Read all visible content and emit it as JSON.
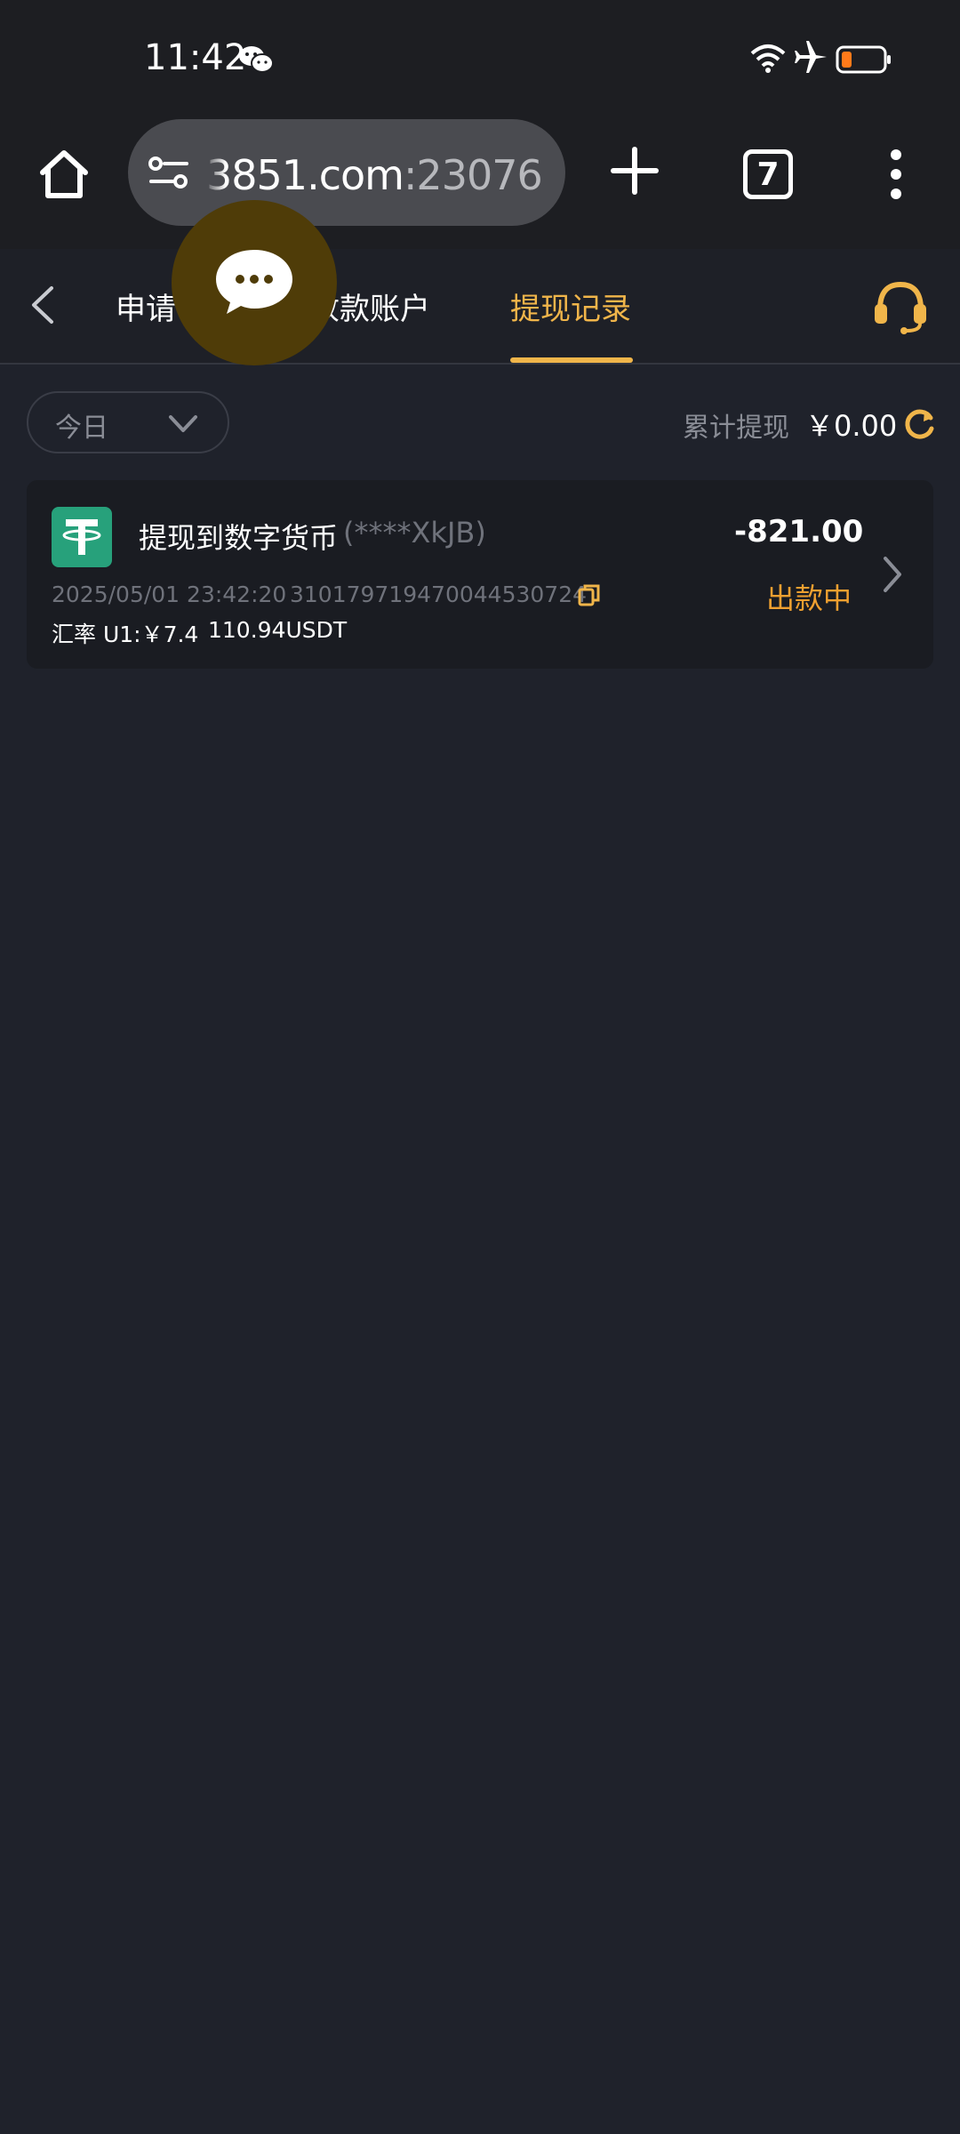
{
  "status_bar": {
    "time": "11:42",
    "icons": [
      "wechat-icon",
      "wifi-icon",
      "airplane-mode-icon",
      "battery-low-icon"
    ]
  },
  "browser": {
    "url_main": "3851.com",
    "url_port": ":23076",
    "tab_count": "7",
    "icons": [
      "home-icon",
      "site-settings-icon",
      "plus-icon",
      "more-icon"
    ]
  },
  "nav": {
    "tabs": [
      {
        "label": "申请"
      },
      {
        "label": "收款账户"
      },
      {
        "label": "提现记录"
      }
    ],
    "active_tab": 2,
    "icons": [
      "back-icon",
      "customer-service-headset-icon",
      "chat-bubble-icon"
    ]
  },
  "filter": {
    "date_range": "今日",
    "total_label": "累计提现",
    "total_value": "￥0.00"
  },
  "records": [
    {
      "title": "提现到数字货币",
      "account": "(****XkJB)",
      "amount": "-821.00",
      "datetime": "2025/05/01 23:42:20",
      "order_id": "310179719470044530724",
      "status": "出款中",
      "rate": "汇率 U1:￥7.4",
      "usdt": "110.94USDT"
    }
  ],
  "colors": {
    "accent": "#f0b54a",
    "status_pending": "#f0a030",
    "background": "#1f222b",
    "card": "#1a1c22",
    "tether_green": "#27a17b"
  }
}
